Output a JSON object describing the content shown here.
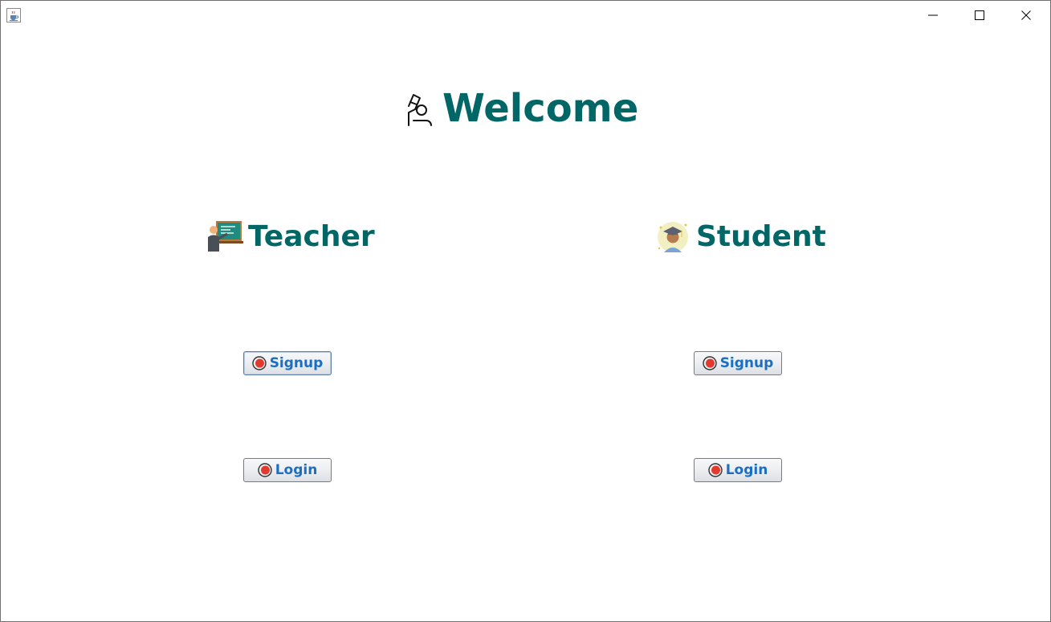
{
  "window": {
    "app_icon": "java-cup-icon",
    "controls": [
      "minimize-icon",
      "maximize-icon",
      "close-icon"
    ]
  },
  "welcome": {
    "title": "Welcome",
    "icon": "raised-hand-student-icon"
  },
  "teacher": {
    "heading": "Teacher",
    "icon": "teacher-blackboard-icon",
    "signup_label": "Signup",
    "login_label": "Login"
  },
  "student": {
    "heading": "Student",
    "icon": "graduate-avatar-icon",
    "signup_label": "Signup",
    "login_label": "Login"
  },
  "colors": {
    "heading": "#006666",
    "button_text": "#1a6fc4",
    "button_icon": "#e23b2e"
  }
}
